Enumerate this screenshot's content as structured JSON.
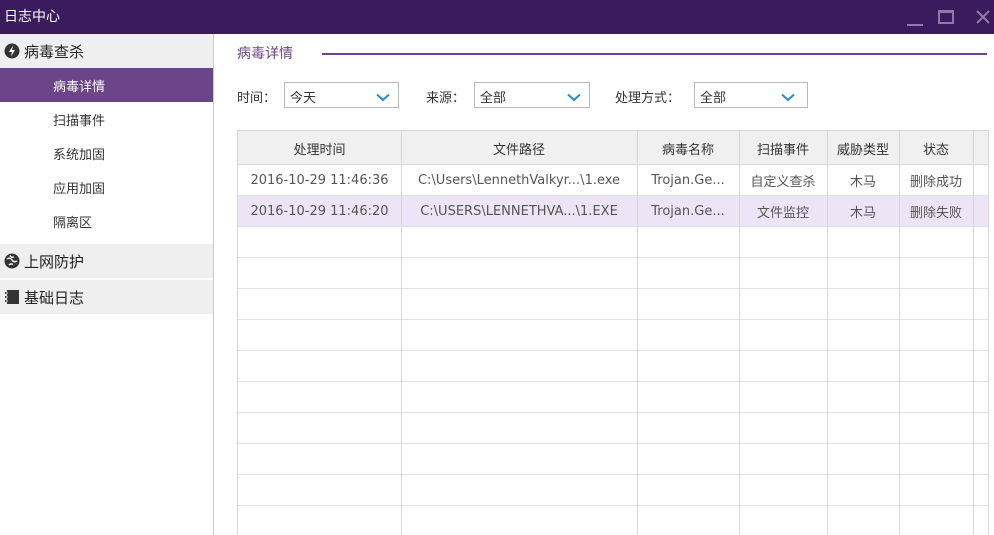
{
  "window": {
    "title": "日志中心"
  },
  "sidebar": {
    "groups": [
      {
        "label": "病毒查杀",
        "icon": "virus-scan-icon"
      },
      {
        "label": "上网防护",
        "icon": "web-protection-icon"
      },
      {
        "label": "基础日志",
        "icon": "log-book-icon"
      }
    ],
    "items": [
      {
        "label": "病毒详情",
        "active": true
      },
      {
        "label": "扫描事件"
      },
      {
        "label": "系统加固"
      },
      {
        "label": "应用加固"
      },
      {
        "label": "隔离区"
      }
    ]
  },
  "main": {
    "section_title": "病毒详情",
    "filters": {
      "time": {
        "label": "时间：",
        "value": "今天"
      },
      "source": {
        "label": "来源：",
        "value": "全部"
      },
      "action": {
        "label": "处理方式：",
        "value": "全部"
      }
    },
    "table": {
      "columns": [
        "处理时间",
        "文件路径",
        "病毒名称",
        "扫描事件",
        "威胁类型",
        "状态"
      ],
      "rows": [
        [
          "2016-10-29 11:46:36",
          "C:\\Users\\LennethValkyr...\\1.exe",
          "Trojan.Ge...",
          "自定义查杀",
          "木马",
          "删除成功"
        ],
        [
          "2016-10-29 11:46:20",
          "C:\\USERS\\LENNETHVA...\\1.EXE",
          "Trojan.Ge...",
          "文件监控",
          "木马",
          "删除失败"
        ]
      ]
    }
  },
  "colors": {
    "titlebar": "#3c1a5e",
    "accent": "#6b4587",
    "selected_row": "#ede4f5"
  }
}
